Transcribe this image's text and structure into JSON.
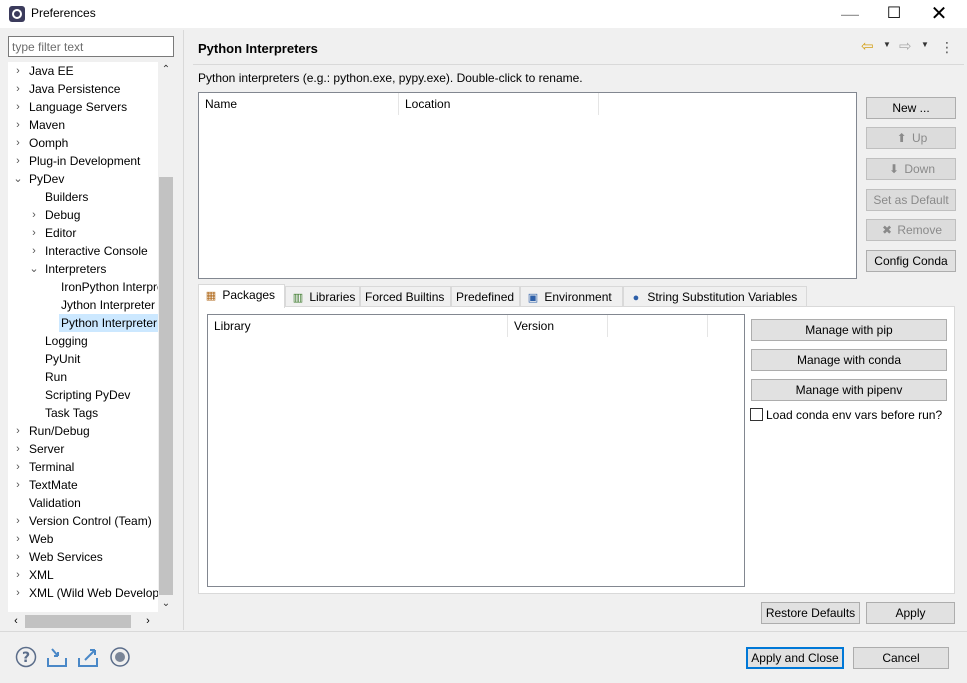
{
  "window": {
    "title": "Preferences"
  },
  "filter": {
    "placeholder": "type filter text"
  },
  "tree": {
    "items": [
      {
        "label": "Java EE",
        "level": 0,
        "expander": "collapsed"
      },
      {
        "label": "Java Persistence",
        "level": 0,
        "expander": "collapsed"
      },
      {
        "label": "Language Servers",
        "level": 0,
        "expander": "collapsed"
      },
      {
        "label": "Maven",
        "level": 0,
        "expander": "collapsed"
      },
      {
        "label": "Oomph",
        "level": 0,
        "expander": "collapsed"
      },
      {
        "label": "Plug-in Development",
        "level": 0,
        "expander": "collapsed"
      },
      {
        "label": "PyDev",
        "level": 0,
        "expander": "expanded"
      },
      {
        "label": "Builders",
        "level": 1,
        "expander": "none"
      },
      {
        "label": "Debug",
        "level": 1,
        "expander": "collapsed"
      },
      {
        "label": "Editor",
        "level": 1,
        "expander": "collapsed"
      },
      {
        "label": "Interactive Console",
        "level": 1,
        "expander": "collapsed"
      },
      {
        "label": "Interpreters",
        "level": 1,
        "expander": "expanded"
      },
      {
        "label": "IronPython Interpreter",
        "level": 2,
        "expander": "none"
      },
      {
        "label": "Jython Interpreter",
        "level": 2,
        "expander": "none"
      },
      {
        "label": "Python Interpreter",
        "level": 2,
        "expander": "none",
        "selected": true
      },
      {
        "label": "Logging",
        "level": 1,
        "expander": "none"
      },
      {
        "label": "PyUnit",
        "level": 1,
        "expander": "none"
      },
      {
        "label": "Run",
        "level": 1,
        "expander": "none"
      },
      {
        "label": "Scripting PyDev",
        "level": 1,
        "expander": "none"
      },
      {
        "label": "Task Tags",
        "level": 1,
        "expander": "none"
      },
      {
        "label": "Run/Debug",
        "level": 0,
        "expander": "collapsed"
      },
      {
        "label": "Server",
        "level": 0,
        "expander": "collapsed"
      },
      {
        "label": "Terminal",
        "level": 0,
        "expander": "collapsed"
      },
      {
        "label": "TextMate",
        "level": 0,
        "expander": "collapsed"
      },
      {
        "label": "Validation",
        "level": 0,
        "expander": "none"
      },
      {
        "label": "Version Control (Team)",
        "level": 0,
        "expander": "collapsed"
      },
      {
        "label": "Web",
        "level": 0,
        "expander": "collapsed"
      },
      {
        "label": "Web Services",
        "level": 0,
        "expander": "collapsed"
      },
      {
        "label": "XML",
        "level": 0,
        "expander": "collapsed"
      },
      {
        "label": "XML (Wild Web Developer)",
        "level": 0,
        "expander": "collapsed"
      }
    ]
  },
  "page": {
    "title": "Python Interpreters",
    "description": "Python interpreters (e.g.: python.exe, pypy.exe).   Double-click to rename.",
    "interpreters_table": {
      "columns": [
        "Name",
        "Location"
      ],
      "rows": []
    },
    "interpreter_buttons": {
      "new": "New ...",
      "up": "Up",
      "down": "Down",
      "set_default": "Set as Default",
      "remove": "Remove",
      "config_conda": "Config Conda"
    },
    "tabs": [
      {
        "label": "Packages",
        "icon": "package-icon",
        "active": true
      },
      {
        "label": "Libraries",
        "icon": "libraries-icon"
      },
      {
        "label": "Forced Builtins",
        "icon": ""
      },
      {
        "label": "Predefined",
        "icon": ""
      },
      {
        "label": "Environment",
        "icon": "environment-icon"
      },
      {
        "label": "String Substitution Variables",
        "icon": "variables-icon"
      }
    ],
    "packages_table": {
      "columns": [
        "Library",
        "Version"
      ],
      "rows": []
    },
    "package_buttons": {
      "pip": "Manage with pip",
      "conda": "Manage with conda",
      "pipenv": "Manage with pipenv"
    },
    "load_conda": {
      "label": "Load conda env vars before run?",
      "checked": false
    },
    "restore_defaults": "Restore Defaults",
    "apply": "Apply"
  },
  "footer": {
    "apply_close": "Apply and Close",
    "cancel": "Cancel",
    "icons": [
      "help-icon",
      "import-icon",
      "export-icon",
      "record-icon"
    ]
  },
  "colors": {
    "selection": "#cce8ff",
    "accent": "#0078d7"
  }
}
